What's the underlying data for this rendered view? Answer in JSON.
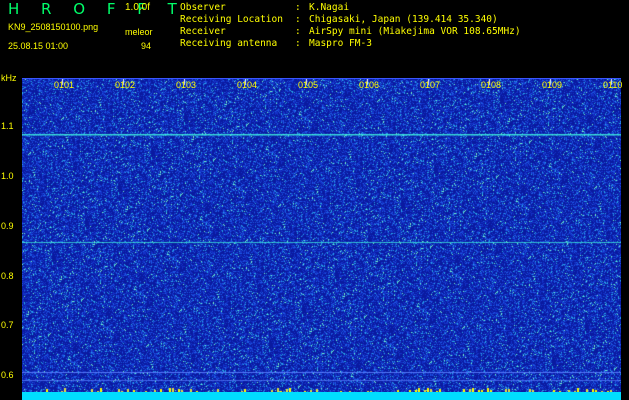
{
  "header": {
    "app_title": "H R O F F T",
    "version": "1.0.0f",
    "filename": "KN9_2508150100.png",
    "mode": "meleor",
    "datetime": "25.08.15 01:00",
    "count": "94",
    "fields": [
      {
        "key": "Observer",
        "value": "K.Nagai"
      },
      {
        "key": "Receiving Location",
        "value": "Chigasaki, Japan (139.414 35.340)"
      },
      {
        "key": "Receiver",
        "value": "AirSpy mini (Miakejima VOR 108.65MHz)"
      },
      {
        "key": "Receiving antenna",
        "value": "Maspro FM-3"
      }
    ]
  },
  "axis": {
    "y_unit": "kHz",
    "y_ticks": [
      "1.1",
      "1.0",
      "0.9",
      "0.8",
      "0.7",
      "0.6"
    ],
    "x_ticks": [
      "0101",
      "0102",
      "0103",
      "0104",
      "0105",
      "0106",
      "0107",
      "0108",
      "0109",
      "0110"
    ]
  },
  "colors": {
    "background": "#000000",
    "waterfall_base": "#0a1aa0",
    "label": "#ffff00",
    "title": "#00ff6a",
    "signal_line": "#30ffe0"
  }
}
